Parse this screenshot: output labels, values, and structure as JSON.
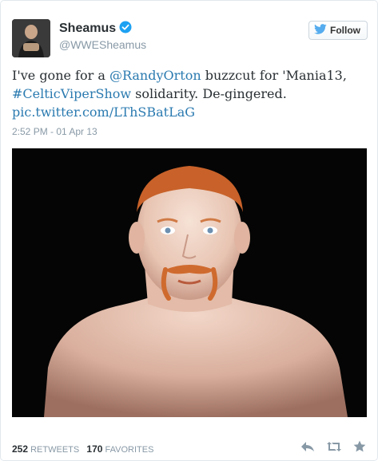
{
  "user": {
    "name": "Sheamus",
    "handle": "@WWESheamus"
  },
  "follow_label": "Follow",
  "tweet": {
    "part1": "I've gone for a ",
    "mention": "@RandyOrton",
    "part2": " buzzcut for 'Mania13, ",
    "hashtag": "#CelticViperShow",
    "part3": " solidarity. De-gingered. ",
    "link": "pic.twitter.com/LThSBatLaG"
  },
  "timestamp": "2:52 PM - 01 Apr 13",
  "stats": {
    "retweets_count": "252",
    "retweets_label": "RETWEETS",
    "favorites_count": "170",
    "favorites_label": "FAVORITES"
  },
  "colors": {
    "link": "#2a7ab0",
    "verified": "#1da1f2",
    "muted": "#8899a6"
  },
  "icons": [
    "verified-badge-icon",
    "twitter-bird-icon",
    "reply-icon",
    "retweet-icon",
    "favorite-star-icon"
  ]
}
